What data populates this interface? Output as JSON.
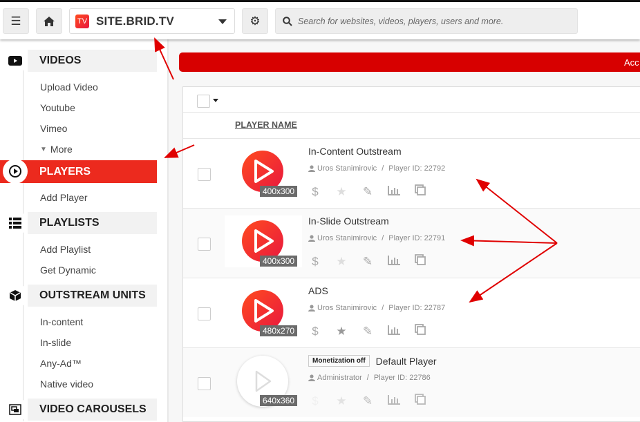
{
  "topbar": {
    "site_name": "SITE.BRID.TV",
    "site_logo": "TV",
    "search_placeholder": "Search for websites, videos, players, users and more."
  },
  "sidebar": {
    "sections": [
      {
        "label": "VIDEOS",
        "icon": "youtube-icon",
        "items": [
          "Upload Video",
          "Youtube",
          "Vimeo",
          "More"
        ]
      },
      {
        "label": "PLAYERS",
        "icon": "play-circle-icon",
        "active": true,
        "items": [
          "Add Player"
        ]
      },
      {
        "label": "PLAYLISTS",
        "icon": "list-icon",
        "items": [
          "Add Playlist",
          "Get Dynamic"
        ]
      },
      {
        "label": "OUTSTREAM UNITS",
        "icon": "cube-icon",
        "items": [
          "In-content",
          "In-slide",
          "Any-Ad™",
          "Native video"
        ]
      },
      {
        "label": "VIDEO CAROUSELS",
        "icon": "carousel-icon",
        "items": []
      }
    ]
  },
  "alert": {
    "text": "Acc",
    "color": "#d70000"
  },
  "table": {
    "column_header": "PLAYER NAME",
    "rows": [
      {
        "name": "In-Content Outstream",
        "user": "Uros Stanimirovic",
        "player_id": "Player ID: 22792",
        "size": "400x300",
        "starred": false
      },
      {
        "name": "In-Slide Outstream",
        "user": "Uros Stanimirovic",
        "player_id": "Player ID: 22791",
        "size": "400x300",
        "starred": false
      },
      {
        "name": "ADS",
        "user": "Uros Stanimirovic",
        "player_id": "Player ID: 22787",
        "size": "480x270",
        "starred": true
      },
      {
        "name": "Default Player",
        "user": "Administrator",
        "player_id": "Player ID: 22786",
        "size": "640x360",
        "starred": false,
        "badge": "Monetization off"
      }
    ]
  },
  "colors": {
    "accent": "#ec2a1e",
    "annotation": "#e00000"
  }
}
